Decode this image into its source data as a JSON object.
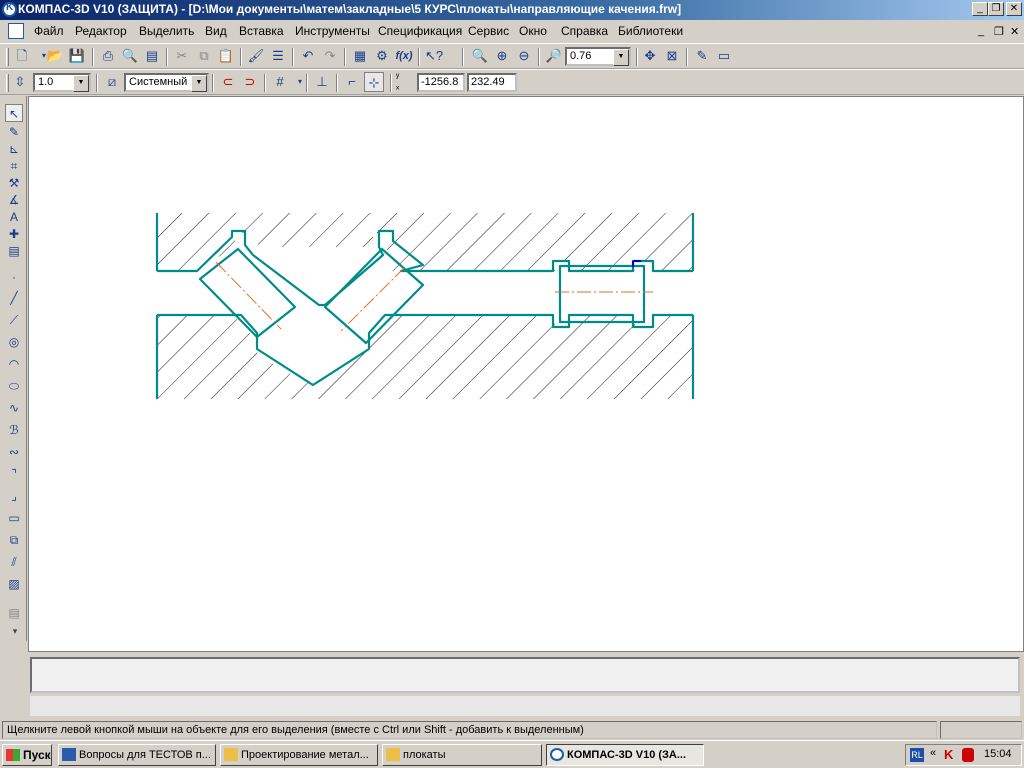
{
  "window": {
    "title": "КОМПАС-3D V10 (ЗАЩИТА) - [D:\\Мои документы\\матем\\закладные\\5 КУРС\\плокаты\\направляющие качения.frw]",
    "caption_buttons": [
      "minimize-icon",
      "restore-icon",
      "close-icon"
    ]
  },
  "menu": {
    "items": [
      "Файл",
      "Редактор",
      "Выделить",
      "Вид",
      "Вставка",
      "Инструменты",
      "Спецификация",
      "Сервис",
      "Окно",
      "Справка",
      "Библиотеки"
    ]
  },
  "toolbar1": {
    "zoom_value": "0.76"
  },
  "toolbar2": {
    "step_value": "1.0",
    "layer_style": "Системный",
    "coord_x": "-1256.8",
    "coord_y": "232.49"
  },
  "status": {
    "hint": "Щелкните левой кнопкой мыши на объекте для его выделения (вместе с Ctrl или Shift - добавить к выделенным)"
  },
  "taskbar": {
    "start_label": "Пуск",
    "tasks": [
      "Вопросы для ТЕСТОВ п...",
      "Проектирование метал...",
      "плокаты",
      "КОМПАС-3D V10 (ЗА..."
    ],
    "lang": "RL",
    "clock": "15:04"
  },
  "colors": {
    "drawing_line": "#008b8b",
    "axis_line": "#e07020",
    "hatch": "#000000",
    "titlebar_start": "#0a246a"
  }
}
